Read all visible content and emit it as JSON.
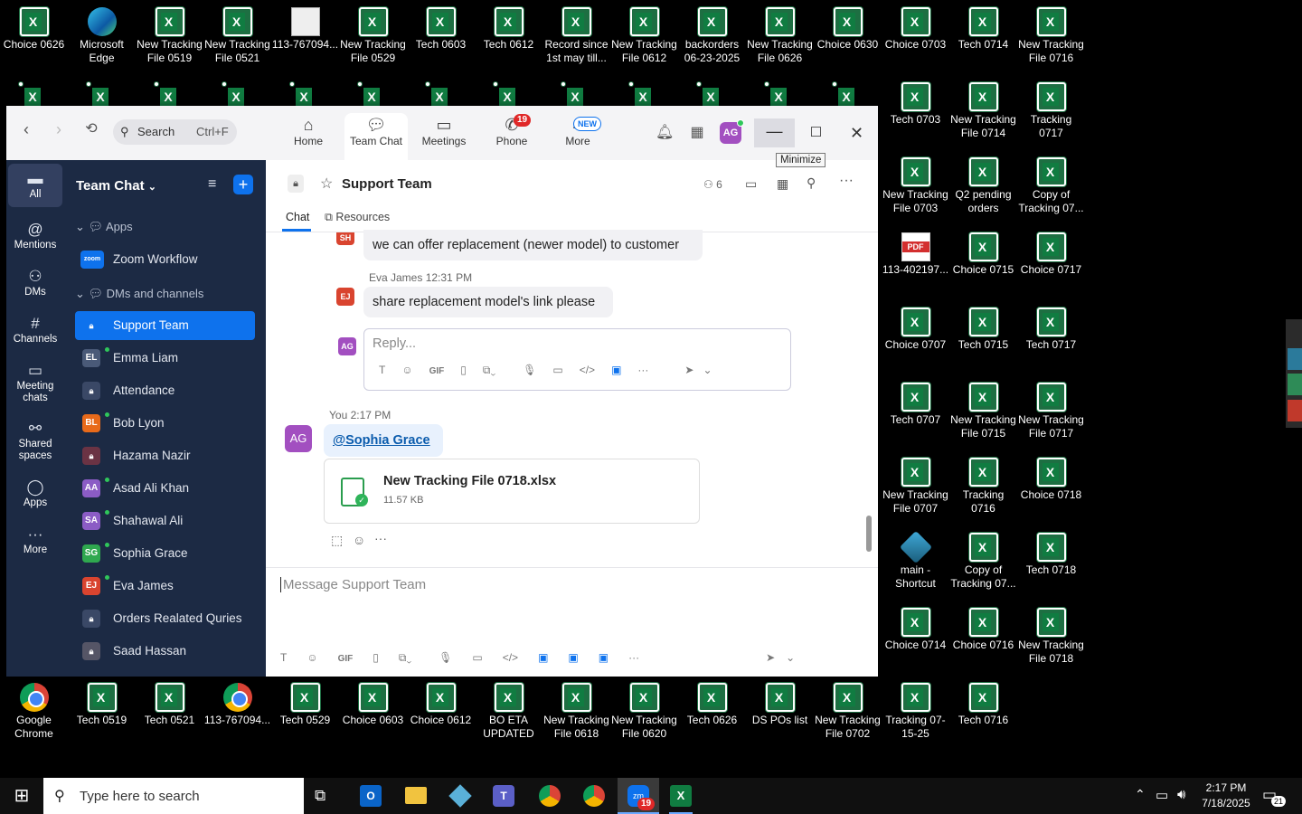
{
  "desktop_icons": [
    {
      "label": "Choice 0626",
      "type": "excel"
    },
    {
      "label": "Microsoft Edge",
      "type": "edge"
    },
    {
      "label": "New Tracking File 0519",
      "type": "excel"
    },
    {
      "label": "New Tracking File 0521",
      "type": "excel"
    },
    {
      "label": "113-767094...",
      "type": "image"
    },
    {
      "label": "New Tracking File 0529",
      "type": "excel"
    },
    {
      "label": "Tech 0603",
      "type": "excel"
    },
    {
      "label": "Tech 0612",
      "type": "excel"
    },
    {
      "label": "Record since 1st may till...",
      "type": "excel"
    },
    {
      "label": "New Tracking File 0612",
      "type": "excel"
    },
    {
      "label": "backorders 06-23-2025",
      "type": "excel"
    },
    {
      "label": "New Tracking File 0626",
      "type": "excel"
    },
    {
      "label": "Choice 0630",
      "type": "excel"
    },
    {
      "label": "Choice 0703",
      "type": "excel"
    },
    {
      "label": "Tech 0714",
      "type": "excel"
    },
    {
      "label": "New Tracking File 0716",
      "type": "excel"
    },
    {
      "label": "Tech 0703",
      "type": "excel"
    },
    {
      "label": "New Tracking File 0714",
      "type": "excel"
    },
    {
      "label": "Tracking 0717",
      "type": "excel"
    },
    {
      "label": "New Tracking File 0703",
      "type": "excel"
    },
    {
      "label": "Q2 pending orders",
      "type": "excel"
    },
    {
      "label": "Copy of Tracking 07...",
      "type": "excel"
    },
    {
      "label": "113-402197...",
      "type": "pdf"
    },
    {
      "label": "Choice 0715",
      "type": "excel"
    },
    {
      "label": "Choice 0717",
      "type": "excel"
    },
    {
      "label": "Choice 0707",
      "type": "excel"
    },
    {
      "label": "Tech 0715",
      "type": "excel"
    },
    {
      "label": "Tech 0717",
      "type": "excel"
    },
    {
      "label": "Tech 0707",
      "type": "excel"
    },
    {
      "label": "New Tracking File 0715",
      "type": "excel"
    },
    {
      "label": "New Tracking File 0717",
      "type": "excel"
    },
    {
      "label": "New Tracking File 0707",
      "type": "excel"
    },
    {
      "label": "Tracking 0716",
      "type": "excel"
    },
    {
      "label": "Choice 0718",
      "type": "excel"
    },
    {
      "label": "main - Shortcut",
      "type": "shortcut"
    },
    {
      "label": "Copy of Tracking 07...",
      "type": "excel"
    },
    {
      "label": "Tech 0718",
      "type": "excel"
    },
    {
      "label": "Choice 0714",
      "type": "excel"
    },
    {
      "label": "Choice 0716",
      "type": "excel"
    },
    {
      "label": "New Tracking File 0718",
      "type": "excel"
    },
    {
      "label": "Google Chrome",
      "type": "chrome"
    },
    {
      "label": "Tech 0519",
      "type": "excel"
    },
    {
      "label": "Tech 0521",
      "type": "excel"
    },
    {
      "label": "113-767094...",
      "type": "chrome"
    },
    {
      "label": "Tech 0529",
      "type": "excel"
    },
    {
      "label": "Choice 0603",
      "type": "excel"
    },
    {
      "label": "Choice 0612",
      "type": "excel"
    },
    {
      "label": "BO ETA UPDATED",
      "type": "excel"
    },
    {
      "label": "New Tracking File 0618",
      "type": "excel"
    },
    {
      "label": "New Tracking File 0620",
      "type": "excel"
    },
    {
      "label": "Tech 0626",
      "type": "excel"
    },
    {
      "label": "DS POs list",
      "type": "excel"
    },
    {
      "label": "New Tracking File 0702",
      "type": "excel"
    },
    {
      "label": "Tracking 07-15-25",
      "type": "excel"
    },
    {
      "label": "Tech 0716",
      "type": "excel"
    }
  ],
  "zoom": {
    "search": {
      "label": "Search",
      "shortcut": "Ctrl+F"
    },
    "tabs": [
      {
        "label": "Home"
      },
      {
        "label": "Team Chat"
      },
      {
        "label": "Meetings"
      },
      {
        "label": "Phone",
        "badge": "19"
      },
      {
        "label": "More",
        "badge": "NEW"
      }
    ],
    "avatar": "AG",
    "minimize_tooltip": "Minimize",
    "left_rail": [
      "All",
      "Mentions",
      "DMs",
      "Channels",
      "Meeting chats",
      "Shared spaces",
      "Apps",
      "More"
    ],
    "panel_title": "Team Chat",
    "sections": {
      "apps": "Apps",
      "dms": "DMs and channels"
    },
    "apps": [
      {
        "name": "Zoom Workflow",
        "tag": "zoom"
      }
    ],
    "channels": [
      {
        "name": "Support Team",
        "initials": "",
        "color": "#0e72ed"
      },
      {
        "name": "Emma Liam",
        "initials": "EL",
        "color": "#4a5a78"
      },
      {
        "name": "Attendance",
        "initials": "",
        "color": "#3a4866"
      },
      {
        "name": "Bob Lyon",
        "initials": "BL",
        "color": "#e86a1a"
      },
      {
        "name": "Hazama Nazir",
        "initials": "",
        "color": "#6b3344"
      },
      {
        "name": "Asad Ali Khan",
        "initials": "AA",
        "color": "#8b5cc5"
      },
      {
        "name": "Shahawal Ali",
        "initials": "SA",
        "color": "#8b5cc5"
      },
      {
        "name": "Sophia Grace",
        "initials": "SG",
        "color": "#2fa84f"
      },
      {
        "name": "Eva James",
        "initials": "EJ",
        "color": "#d9442f"
      },
      {
        "name": "Orders Realated Quries",
        "initials": "",
        "color": "#3a4866"
      },
      {
        "name": "Saad Hassan",
        "initials": "",
        "color": "#556"
      }
    ],
    "chat": {
      "title": "Support Team",
      "members": "6",
      "tabs": [
        "Chat",
        "Resources"
      ],
      "messages": [
        {
          "initials": "SH",
          "text": "we can offer replacement (newer model) to customer"
        },
        {
          "initials": "EJ",
          "sender": "Eva James",
          "time": "12:31 PM",
          "text": "share replacement model's link please"
        }
      ],
      "reply_placeholder": "Reply...",
      "reply_avatar": "AG",
      "you_line": {
        "sender": "You",
        "time": "2:17 PM"
      },
      "mention": "@Sophia Grace",
      "file": {
        "name": "New Tracking File 0718.xlsx",
        "size": "11.57 KB"
      },
      "compose_placeholder": "Message Support Team"
    }
  },
  "taskbar": {
    "search_placeholder": "Type here to search",
    "time": "2:17 PM",
    "date": "7/18/2025",
    "notif_count": "21",
    "zoom_badge": "19"
  },
  "colors": {
    "zoom_sidebar": "#1c2a44",
    "accent": "#0e72ed",
    "taskbar": "#101010"
  }
}
